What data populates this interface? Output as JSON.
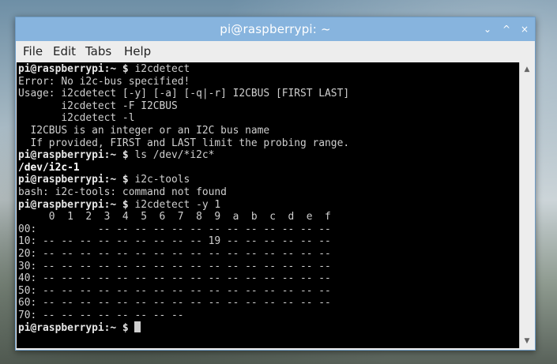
{
  "window": {
    "title": "pi@raspberrypi: ~",
    "buttons": {
      "minimize": "⌄",
      "maximize": "^",
      "close": "×"
    }
  },
  "menu": [
    "File",
    "Edit",
    "Tabs",
    "Help"
  ],
  "terminal": {
    "lines": [
      {
        "prompt": "pi@raspberrypi:~ $ ",
        "cmd": "i2cdetect"
      },
      {
        "text": "Error: No i2c-bus specified!"
      },
      {
        "text": "Usage: i2cdetect [-y] [-a] [-q|-r] I2CBUS [FIRST LAST]"
      },
      {
        "text": "       i2cdetect -F I2CBUS"
      },
      {
        "text": "       i2cdetect -l"
      },
      {
        "text": "  I2CBUS is an integer or an I2C bus name"
      },
      {
        "text": "  If provided, FIRST and LAST limit the probing range."
      },
      {
        "prompt": "pi@raspberrypi:~ $ ",
        "cmd": "ls /dev/*i2c*"
      },
      {
        "bold": "/dev/i2c-1"
      },
      {
        "prompt": "pi@raspberrypi:~ $ ",
        "cmd": "i2c-tools"
      },
      {
        "text": "bash: i2c-tools: command not found"
      },
      {
        "prompt": "pi@raspberrypi:~ $ ",
        "cmd": "i2cdetect -y 1"
      },
      {
        "text": "     0  1  2  3  4  5  6  7  8  9  a  b  c  d  e  f"
      },
      {
        "text": "00:          -- -- -- -- -- -- -- -- -- -- -- -- --"
      },
      {
        "text": "10: -- -- -- -- -- -- -- -- -- 19 -- -- -- -- -- --"
      },
      {
        "text": "20: -- -- -- -- -- -- -- -- -- -- -- -- -- -- -- --"
      },
      {
        "text": "30: -- -- -- -- -- -- -- -- -- -- -- -- -- -- -- --"
      },
      {
        "text": "40: -- -- -- -- -- -- -- -- -- -- -- -- -- -- -- --"
      },
      {
        "text": "50: -- -- -- -- -- -- -- -- -- -- -- -- -- -- -- --"
      },
      {
        "text": "60: -- -- -- -- -- -- -- -- -- -- -- -- -- -- -- --"
      },
      {
        "text": "70: -- -- -- -- -- -- -- --"
      },
      {
        "prompt": "pi@raspberrypi:~ $ ",
        "cursor": true
      }
    ]
  }
}
